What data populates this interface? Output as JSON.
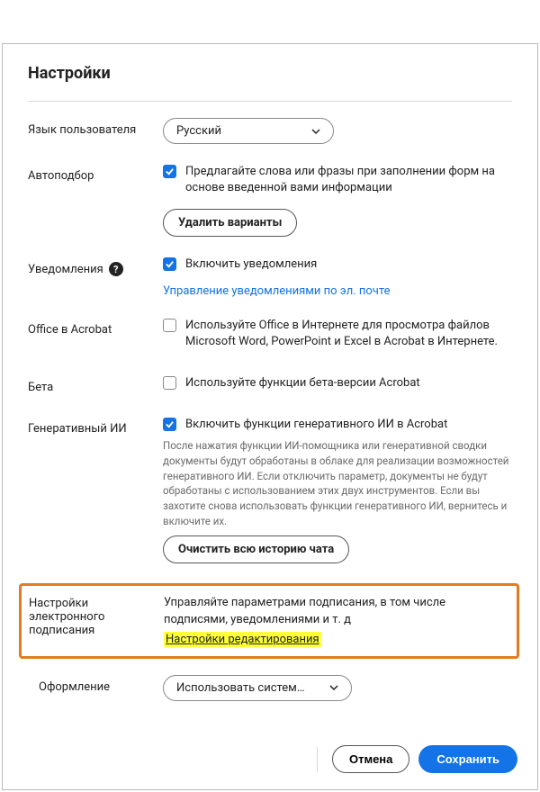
{
  "title": "Настройки",
  "rows": {
    "language": {
      "label": "Язык пользователя",
      "value": "Русский"
    },
    "autocomplete": {
      "label": "Автоподбор",
      "checkbox_text": "Предлагайте слова или фразы при заполнении форм на основе введенной вами информации",
      "button": "Удалить варианты"
    },
    "notifications": {
      "label": "Уведомления",
      "checkbox_text": "Включить уведомления",
      "link": "Управление уведомлениями по эл. почте"
    },
    "office": {
      "label": "Office в Acrobat",
      "checkbox_text": "Используйте Office в Интернете для просмотра файлов Microsoft Word, PowerPoint и Excel в Acrobat в Интернете."
    },
    "beta": {
      "label": "Бета",
      "checkbox_text": "Используйте функции бета-версии Acrobat"
    },
    "genai": {
      "label": "Генеративный ИИ",
      "checkbox_text": "Включить функции генеративного ИИ в Acrobat",
      "description": "После нажатия функции ИИ-помощника или генеративной сводки документы будут обработаны в облаке для реализации возможностей генеративного ИИ. Если отключить параметр, документы не будут обработаны с использованием этих двух инструментов. Если вы захотите снова использовать функции генеративного ИИ, вернитесь и включите их.",
      "button": "Очистить всю историю чата"
    },
    "esign": {
      "label_line1": "Настройки",
      "label_line2": "электронного",
      "label_line3": "подписания",
      "text": "Управляйте параметрами подписания, в том числе подписями, уведомлениями и т. д",
      "link": "Настройки редактирования"
    },
    "appearance": {
      "label": "Оформление",
      "value": "Использовать систем…"
    }
  },
  "footer": {
    "cancel": "Отмена",
    "save": "Сохранить"
  }
}
